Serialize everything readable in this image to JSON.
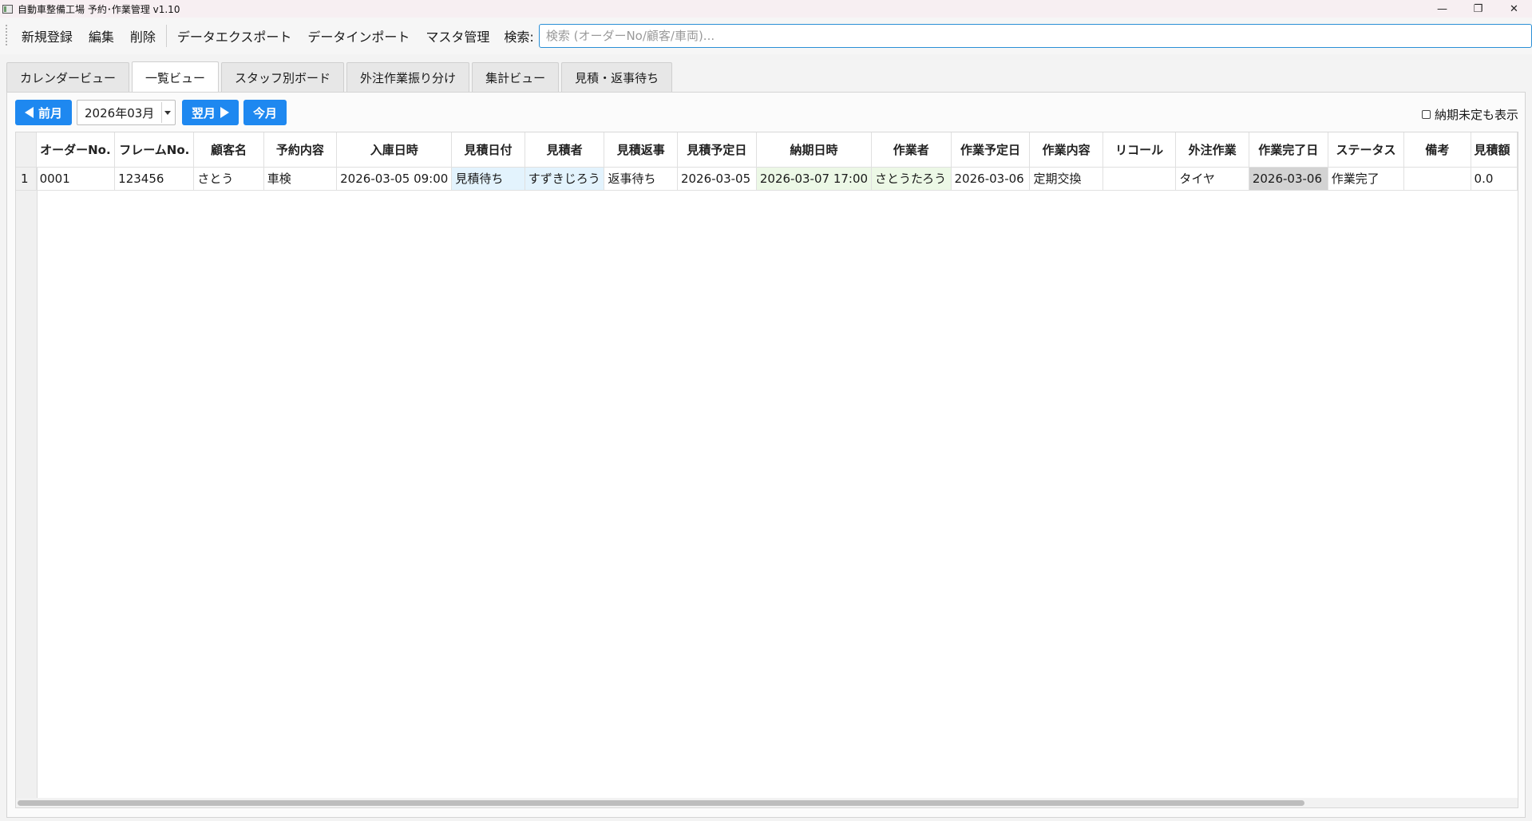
{
  "window": {
    "title": "自動車整備工場 予約･作業管理 v1.10",
    "controls": {
      "minimize": "—",
      "maximize": "❐",
      "close": "✕"
    }
  },
  "menu": {
    "new": "新規登録",
    "edit": "編集",
    "delete": "削除",
    "export": "データエクスポート",
    "import": "データインポート",
    "master": "マスタ管理",
    "search_label": "検索:",
    "search_placeholder": "検索 (オーダーNo/顧客/車両)...",
    "search_value": ""
  },
  "tabs": [
    {
      "label": "カレンダービュー",
      "active": false
    },
    {
      "label": "一覧ビュー",
      "active": true
    },
    {
      "label": "スタッフ別ボード",
      "active": false
    },
    {
      "label": "外注作業振り分け",
      "active": false
    },
    {
      "label": "集計ビュー",
      "active": false
    },
    {
      "label": "見積・返事待ち",
      "active": false
    }
  ],
  "nav": {
    "prev": "前月",
    "month": "2026年03月",
    "next": "翌月",
    "today": "今月",
    "show_undated_label": "納期未定も表示",
    "show_undated": false
  },
  "table": {
    "columns": [
      "オーダーNo.",
      "フレームNo.",
      "顧客名",
      "予約内容",
      "入庫日時",
      "見積日付",
      "見積者",
      "見積返事",
      "見積予定日",
      "納期日時",
      "作業者",
      "作業予定日",
      "作業内容",
      "リコール",
      "外注作業",
      "作業完了日",
      "ステータス",
      "備考",
      "見積額"
    ],
    "rows": [
      {
        "num": "1",
        "cells": [
          "0001",
          "123456",
          "さとう",
          "車検",
          "2026-03-05 09:00",
          "見積待ち",
          "すずきじろう",
          "返事待ち",
          "2026-03-05",
          "2026-03-07 17:00",
          "さとうたろう",
          "2026-03-06",
          "定期交換",
          "",
          "タイヤ",
          "2026-03-06",
          "作業完了",
          "",
          "0.0"
        ]
      }
    ]
  },
  "colors": {
    "accent": "#1e88f0",
    "highlight_blue": "#e3f3fd",
    "highlight_green": "#ecf8e6",
    "highlight_gray": "#d3d3d3"
  }
}
